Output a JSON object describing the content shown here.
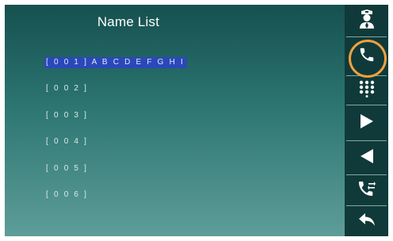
{
  "header": {
    "title": "Name List"
  },
  "name_list": [
    {
      "label": "[ 0 0 1 ] A B C D E F G H I",
      "selected": true
    },
    {
      "label": "[ 0 0 2 ]",
      "selected": false
    },
    {
      "label": "[ 0 0 3 ]",
      "selected": false
    },
    {
      "label": "[ 0 0 4 ]",
      "selected": false
    },
    {
      "label": "[ 0 0 5 ]",
      "selected": false
    },
    {
      "label": "[ 0 0 6 ]",
      "selected": false
    }
  ],
  "side_buttons": [
    {
      "icon": "guard-icon"
    },
    {
      "icon": "phone-icon",
      "highlighted": true
    },
    {
      "icon": "keypad-icon"
    },
    {
      "icon": "play-right-icon"
    },
    {
      "icon": "play-left-icon"
    },
    {
      "icon": "call-transfer-icon"
    },
    {
      "icon": "back-icon"
    }
  ],
  "colors": {
    "selection": "#2b48b8",
    "highlight_ring": "#f0a040",
    "rail": "#0f3a39",
    "background_top": "#15504f",
    "background_bottom": "#5e9d99"
  }
}
